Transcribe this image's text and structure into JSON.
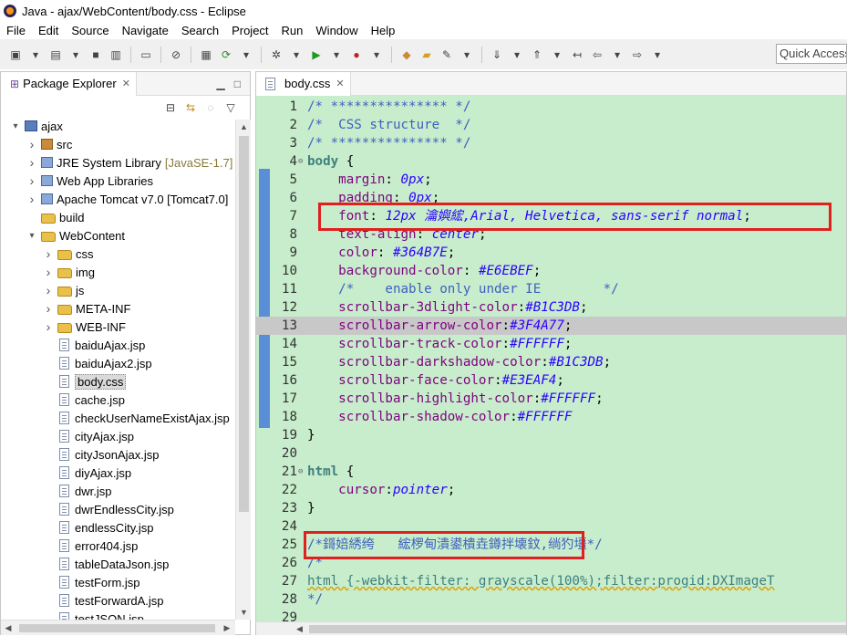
{
  "window": {
    "title": "Java - ajax/WebContent/body.css - Eclipse"
  },
  "menubar": {
    "items": [
      "File",
      "Edit",
      "Source",
      "Navigate",
      "Search",
      "Project",
      "Run",
      "Window",
      "Help"
    ]
  },
  "toolbar": {
    "quick_access_placeholder": "Quick Access"
  },
  "explorer": {
    "tab_label": "Package Explorer",
    "tree": [
      {
        "label": "ajax",
        "icon": "project-icon",
        "twisty": "expanded",
        "level": 0
      },
      {
        "label": "src",
        "icon": "package-icon",
        "twisty": "collapsed",
        "level": 1
      },
      {
        "label": "JRE System Library",
        "decor": "[JavaSE-1.7]",
        "icon": "library-icon",
        "twisty": "collapsed",
        "level": 1
      },
      {
        "label": "Web App Libraries",
        "icon": "library-icon",
        "twisty": "collapsed",
        "level": 1
      },
      {
        "label": "Apache Tomcat v7.0 [Tomcat7.0]",
        "icon": "library-icon",
        "twisty": "collapsed",
        "level": 1
      },
      {
        "label": "build",
        "icon": "folder-icon",
        "twisty": "none",
        "level": 1
      },
      {
        "label": "WebContent",
        "icon": "folder-icon",
        "twisty": "expanded",
        "level": 1
      },
      {
        "label": "css",
        "icon": "folder-icon",
        "twisty": "collapsed",
        "level": 2
      },
      {
        "label": "img",
        "icon": "folder-icon",
        "twisty": "collapsed",
        "level": 2
      },
      {
        "label": "js",
        "icon": "folder-icon",
        "twisty": "collapsed",
        "level": 2
      },
      {
        "label": "META-INF",
        "icon": "folder-icon",
        "twisty": "collapsed",
        "level": 2
      },
      {
        "label": "WEB-INF",
        "icon": "folder-icon",
        "twisty": "collapsed",
        "level": 2
      },
      {
        "label": "baiduAjax.jsp",
        "icon": "file-icon",
        "twisty": "none",
        "level": 2
      },
      {
        "label": "baiduAjax2.jsp",
        "icon": "file-icon",
        "twisty": "none",
        "level": 2
      },
      {
        "label": "body.css",
        "icon": "file-icon",
        "twisty": "none",
        "level": 2,
        "selected": true
      },
      {
        "label": "cache.jsp",
        "icon": "file-icon",
        "twisty": "none",
        "level": 2
      },
      {
        "label": "checkUserNameExistAjax.jsp",
        "icon": "file-icon",
        "twisty": "none",
        "level": 2
      },
      {
        "label": "cityAjax.jsp",
        "icon": "file-icon",
        "twisty": "none",
        "level": 2
      },
      {
        "label": "cityJsonAjax.jsp",
        "icon": "file-icon",
        "twisty": "none",
        "level": 2
      },
      {
        "label": "diyAjax.jsp",
        "icon": "file-icon",
        "twisty": "none",
        "level": 2
      },
      {
        "label": "dwr.jsp",
        "icon": "file-icon",
        "twisty": "none",
        "level": 2
      },
      {
        "label": "dwrEndlessCity.jsp",
        "icon": "file-icon",
        "twisty": "none",
        "level": 2
      },
      {
        "label": "endlessCity.jsp",
        "icon": "file-icon",
        "twisty": "none",
        "level": 2
      },
      {
        "label": "error404.jsp",
        "icon": "file-icon",
        "twisty": "none",
        "level": 2
      },
      {
        "label": "tableDataJson.jsp",
        "icon": "file-icon",
        "twisty": "none",
        "level": 2
      },
      {
        "label": "testForm.jsp",
        "icon": "file-icon",
        "twisty": "none",
        "level": 2
      },
      {
        "label": "testForwardA.jsp",
        "icon": "file-icon",
        "twisty": "none",
        "level": 2
      },
      {
        "label": "testJSON.jsp",
        "icon": "file-icon",
        "twisty": "none",
        "level": 2
      }
    ]
  },
  "editor": {
    "tab_label": "body.css",
    "current_line": 13,
    "lines": [
      {
        "n": 1,
        "fold": "",
        "tokens": [
          [
            "c",
            "/* *************** */"
          ]
        ]
      },
      {
        "n": 2,
        "fold": "",
        "tokens": [
          [
            "c",
            "/*  CSS structure  */"
          ]
        ]
      },
      {
        "n": 3,
        "fold": "",
        "tokens": [
          [
            "c",
            "/* *************** */"
          ]
        ]
      },
      {
        "n": 4,
        "fold": "⊖",
        "tokens": [
          [
            "s",
            "body"
          ],
          [
            "p",
            " {"
          ]
        ]
      },
      {
        "n": 5,
        "fold": "",
        "tokens": [
          [
            "p",
            "    "
          ],
          [
            "k",
            "margin"
          ],
          [
            "p",
            ": "
          ],
          [
            "v",
            "0px"
          ],
          [
            "p",
            ";"
          ]
        ]
      },
      {
        "n": 6,
        "fold": "",
        "tokens": [
          [
            "p",
            "    "
          ],
          [
            "k",
            "padding"
          ],
          [
            "p",
            ": "
          ],
          [
            "v",
            "0px"
          ],
          [
            "p",
            ";"
          ]
        ]
      },
      {
        "n": 7,
        "fold": "",
        "tokens": [
          [
            "p",
            "    "
          ],
          [
            "k",
            "font"
          ],
          [
            "p",
            ": "
          ],
          [
            "v",
            "12px 瀹嬩綋,Arial, Helvetica, sans-serif normal"
          ],
          [
            "p",
            ";"
          ]
        ]
      },
      {
        "n": 8,
        "fold": "",
        "tokens": [
          [
            "p",
            "    "
          ],
          [
            "k",
            "text-align"
          ],
          [
            "p",
            ": "
          ],
          [
            "v",
            "center"
          ],
          [
            "p",
            ";"
          ]
        ]
      },
      {
        "n": 9,
        "fold": "",
        "tokens": [
          [
            "p",
            "    "
          ],
          [
            "k",
            "color"
          ],
          [
            "p",
            ": "
          ],
          [
            "v",
            "#364B7E"
          ],
          [
            "p",
            ";"
          ]
        ]
      },
      {
        "n": 10,
        "fold": "",
        "tokens": [
          [
            "p",
            "    "
          ],
          [
            "k",
            "background-color"
          ],
          [
            "p",
            ": "
          ],
          [
            "v",
            "#E6EBEF"
          ],
          [
            "p",
            ";"
          ]
        ]
      },
      {
        "n": 11,
        "fold": "",
        "tokens": [
          [
            "p",
            "    "
          ],
          [
            "c",
            "/*    enable only under IE        */"
          ]
        ]
      },
      {
        "n": 12,
        "fold": "",
        "tokens": [
          [
            "p",
            "    "
          ],
          [
            "k",
            "scrollbar-3dlight-color"
          ],
          [
            "p",
            ":"
          ],
          [
            "v",
            "#B1C3DB"
          ],
          [
            "p",
            ";"
          ]
        ]
      },
      {
        "n": 13,
        "fold": "",
        "tokens": [
          [
            "p",
            "    "
          ],
          [
            "k",
            "scrollbar-arrow-color"
          ],
          [
            "p",
            ":"
          ],
          [
            "v",
            "#3F4A77"
          ],
          [
            "p",
            ";"
          ]
        ]
      },
      {
        "n": 14,
        "fold": "",
        "tokens": [
          [
            "p",
            "    "
          ],
          [
            "k",
            "scrollbar-track-color"
          ],
          [
            "p",
            ":"
          ],
          [
            "v",
            "#FFFFFF"
          ],
          [
            "p",
            ";"
          ]
        ]
      },
      {
        "n": 15,
        "fold": "",
        "tokens": [
          [
            "p",
            "    "
          ],
          [
            "k",
            "scrollbar-darkshadow-color"
          ],
          [
            "p",
            ":"
          ],
          [
            "v",
            "#B1C3DB"
          ],
          [
            "p",
            ";"
          ]
        ]
      },
      {
        "n": 16,
        "fold": "",
        "tokens": [
          [
            "p",
            "    "
          ],
          [
            "k",
            "scrollbar-face-color"
          ],
          [
            "p",
            ":"
          ],
          [
            "v",
            "#E3EAF4"
          ],
          [
            "p",
            ";"
          ]
        ]
      },
      {
        "n": 17,
        "fold": "",
        "tokens": [
          [
            "p",
            "    "
          ],
          [
            "k",
            "scrollbar-highlight-color"
          ],
          [
            "p",
            ":"
          ],
          [
            "v",
            "#FFFFFF"
          ],
          [
            "p",
            ";"
          ]
        ]
      },
      {
        "n": 18,
        "fold": "",
        "tokens": [
          [
            "p",
            "    "
          ],
          [
            "k",
            "scrollbar-shadow-color"
          ],
          [
            "p",
            ":"
          ],
          [
            "v",
            "#FFFFFF"
          ]
        ]
      },
      {
        "n": 19,
        "fold": "",
        "tokens": [
          [
            "p",
            "}"
          ]
        ]
      },
      {
        "n": 20,
        "fold": "",
        "tokens": []
      },
      {
        "n": 21,
        "fold": "⊖",
        "tokens": [
          [
            "s",
            "html"
          ],
          [
            "p",
            " {"
          ]
        ]
      },
      {
        "n": 22,
        "fold": "",
        "tokens": [
          [
            "p",
            "    "
          ],
          [
            "k",
            "cursor"
          ],
          [
            "p",
            ":"
          ],
          [
            "v",
            "pointer"
          ],
          [
            "p",
            ";"
          ]
        ]
      },
      {
        "n": 23,
        "fold": "",
        "tokens": [
          [
            "p",
            "}"
          ]
        ]
      },
      {
        "n": 24,
        "fold": "",
        "tokens": []
      },
      {
        "n": 25,
        "fold": "",
        "tokens": [
          [
            "c",
            "/*鎶婄綉绔   綋椤甸潰鍙樻垚鐏拌壊鈫,绱犳壃*/"
          ]
        ]
      },
      {
        "n": 26,
        "fold": "",
        "tokens": [
          [
            "c",
            "/*"
          ]
        ]
      },
      {
        "n": 27,
        "fold": "",
        "tokens": [
          [
            "h",
            "html {-webkit-filter: grayscale(100%);filter:progid:DXImageT"
          ]
        ]
      },
      {
        "n": 28,
        "fold": "",
        "tokens": [
          [
            "c",
            "*/"
          ]
        ]
      },
      {
        "n": 29,
        "fold": "",
        "tokens": []
      }
    ],
    "highlight_lines": [
      7,
      25
    ]
  },
  "colors": {
    "editor_bg": "#C7EDCC",
    "comment": "#3F5FBF",
    "selector": "#3F7F7F",
    "property": "#7F007F",
    "value": "#2A00FF",
    "annotation_box": "#E02020",
    "current_line": "#C8C8C8"
  }
}
